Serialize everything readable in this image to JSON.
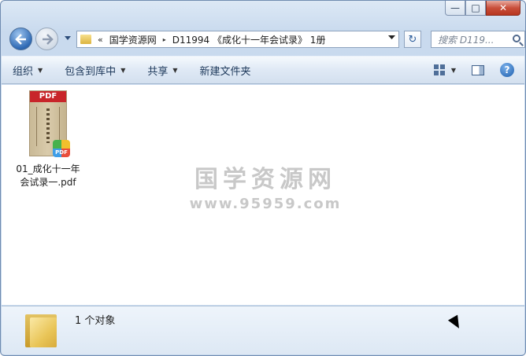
{
  "window": {
    "minimize_label": "—",
    "maximize_label": "□",
    "close_label": "✕"
  },
  "address": {
    "overflow": "«",
    "path": [
      "国学资源网",
      "D11994 《成化十一年会试录》 1册"
    ],
    "separator": "▸"
  },
  "search": {
    "placeholder": "搜索 D119..."
  },
  "toolbar": {
    "organize": "组织",
    "include_in_library": "包含到库中",
    "share": "共享",
    "new_folder": "新建文件夹",
    "help": "?"
  },
  "files": [
    {
      "name_line1": "01_成化十一年",
      "name_line2": "会试录一.pdf",
      "thumb_label": "PDF",
      "badge_label": "PDF",
      "type": "pdf"
    }
  ],
  "watermark": {
    "title": "国学资源网",
    "url": "www.95959.com"
  },
  "details": {
    "item_count": "1 个对象"
  },
  "colors": {
    "pdf_red": "#c8252a",
    "chrome_blue": "#c4d6eb"
  },
  "icons": [
    "back-icon",
    "forward-icon",
    "folder-icon",
    "refresh-icon",
    "search-icon",
    "view-icon",
    "preview-pane-icon",
    "help-icon",
    "pdf-icon",
    "cursor-icon"
  ]
}
